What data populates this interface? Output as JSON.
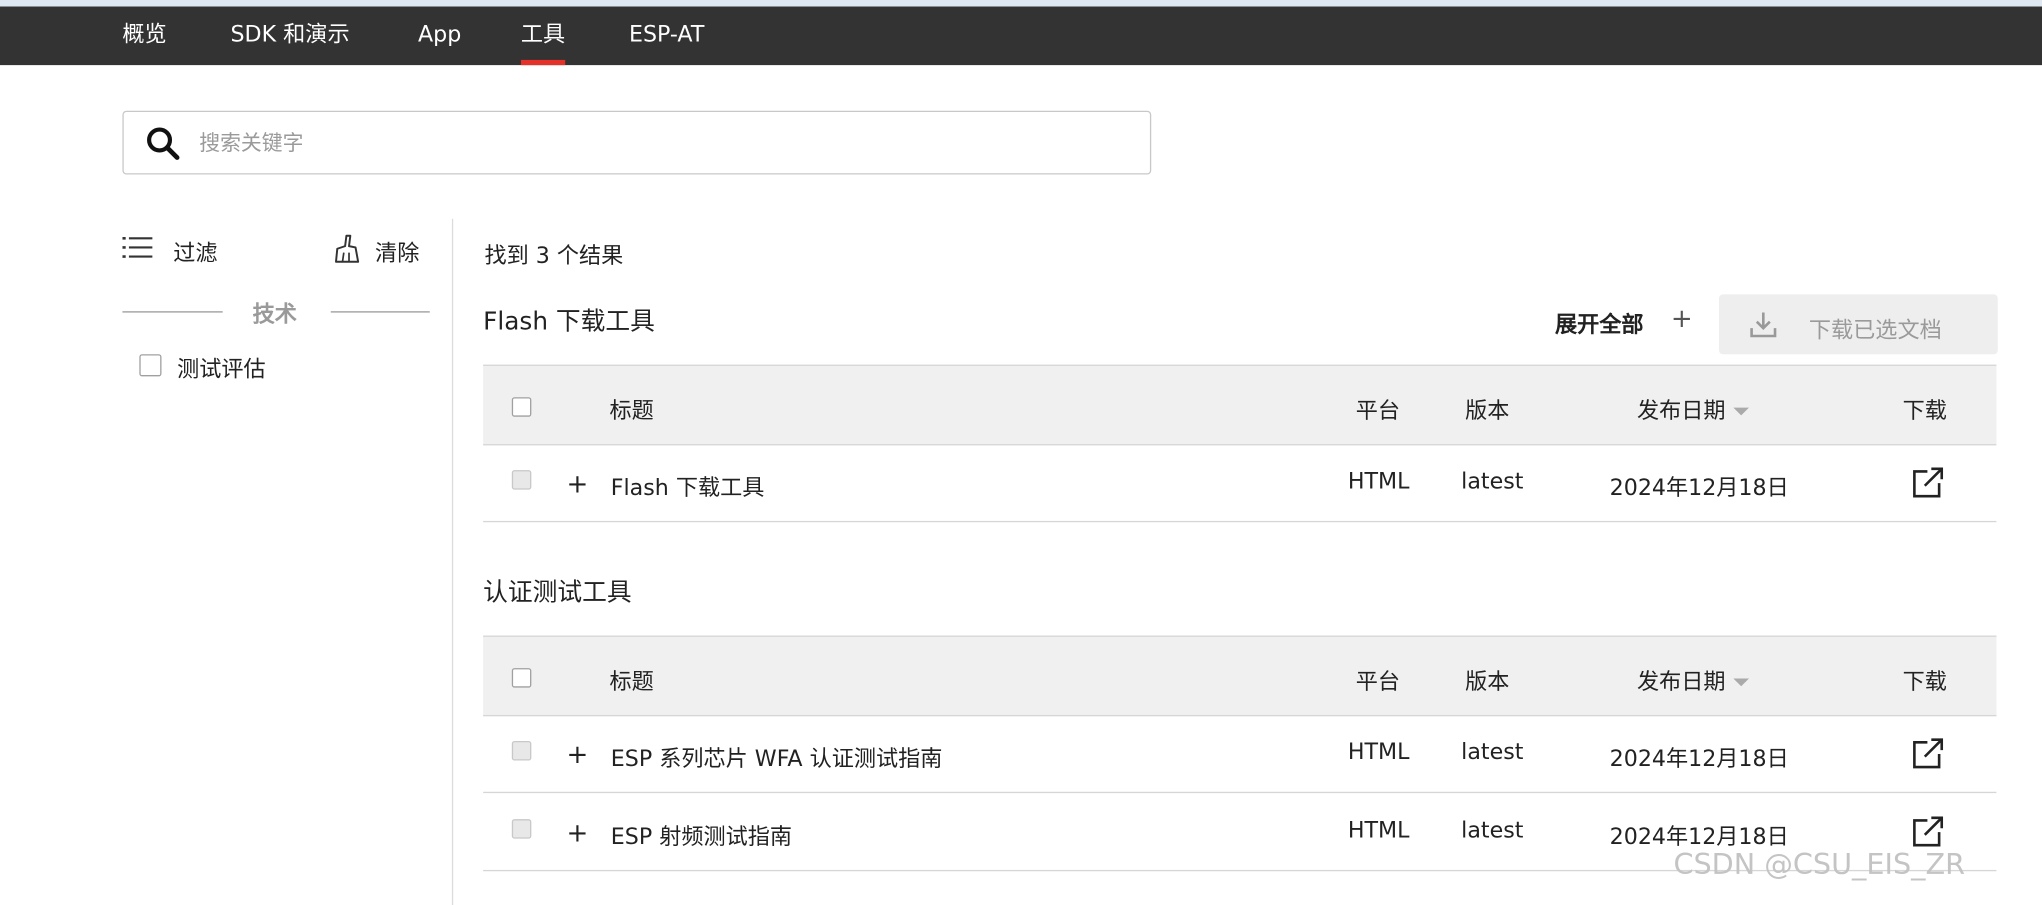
{
  "nav": {
    "items": [
      {
        "label": "概览",
        "active": false
      },
      {
        "label": "SDK 和演示",
        "active": false
      },
      {
        "label": "App",
        "active": false
      },
      {
        "label": "工具",
        "active": true
      },
      {
        "label": "ESP-AT",
        "active": false
      }
    ]
  },
  "search": {
    "placeholder": "搜索关键字",
    "value": ""
  },
  "sidebar": {
    "filter_label": "过滤",
    "clear_label": "清除",
    "section_label": "技术",
    "options": [
      {
        "label": "测试评估",
        "checked": false
      }
    ]
  },
  "results": {
    "count_text": "找到 3 个结果"
  },
  "actions": {
    "expand_all_label": "展开全部",
    "expand_all_symbol": "+",
    "download_selected_label": "下载已选文档"
  },
  "table_headers": {
    "title": "标题",
    "platform": "平台",
    "version": "版本",
    "date": "发布日期",
    "download": "下载"
  },
  "groups": [
    {
      "name": "Flash 下载工具",
      "rows": [
        {
          "expand": "+",
          "title": "Flash 下载工具",
          "platform": "HTML",
          "version": "latest",
          "date": "2024年12月18日"
        }
      ]
    },
    {
      "name": "认证测试工具",
      "rows": [
        {
          "expand": "+",
          "title": "ESP 系列芯片 WFA 认证测试指南",
          "platform": "HTML",
          "version": "latest",
          "date": "2024年12月18日"
        },
        {
          "expand": "+",
          "title": "ESP 射频测试指南",
          "platform": "HTML",
          "version": "latest",
          "date": "2024年12月18日"
        }
      ]
    }
  ],
  "watermark": "CSDN @CSU_EIS_ZR",
  "colors": {
    "nav_bg": "#333333",
    "active_underline": "#e4322b",
    "header_bg": "#f0f0f0"
  }
}
